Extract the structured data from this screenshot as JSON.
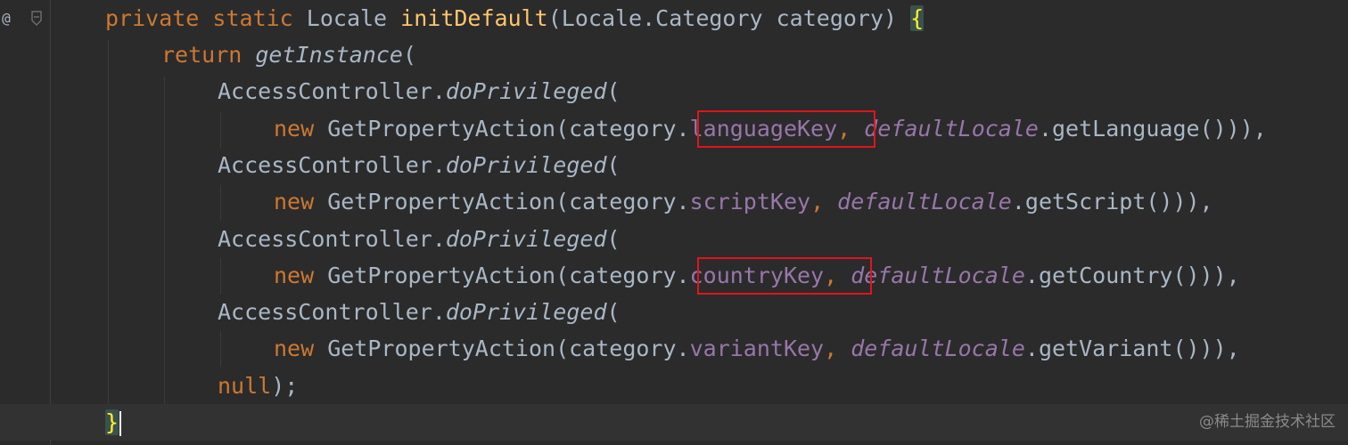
{
  "gutter": {
    "override_marker": "@"
  },
  "code": {
    "line1": {
      "kw1": "private",
      "kw2": "static",
      "type": "Locale",
      "method": "initDefault",
      "params": "(Locale.Category category) ",
      "brace": "{"
    },
    "line2": {
      "kw": "return",
      "method": "getInstance",
      "rest": "("
    },
    "line3": {
      "cls": "AccessController.",
      "method": "doPrivileged",
      "rest": "("
    },
    "line4": {
      "kw": "new",
      "pre": " GetPropertyAction(category.",
      "field": "languageKey",
      "comma": ", ",
      "sfield": "defaultLocale",
      "post": ".getLanguage())),"
    },
    "line5": {
      "cls": "AccessController.",
      "method": "doPrivileged",
      "rest": "("
    },
    "line6": {
      "kw": "new",
      "pre": " GetPropertyAction(category.",
      "field": "scriptKey",
      "comma": ", ",
      "sfield": "defaultLocale",
      "post": ".getScript())),"
    },
    "line7": {
      "cls": "AccessController.",
      "method": "doPrivileged",
      "rest": "("
    },
    "line8": {
      "kw": "new",
      "pre": " GetPropertyAction(category.",
      "field": "countryKey",
      "comma": ", ",
      "sfield": "defaultLocale",
      "post": ".getCountry())),"
    },
    "line9": {
      "cls": "AccessController.",
      "method": "doPrivileged",
      "rest": "("
    },
    "line10": {
      "kw": "new",
      "pre": " GetPropertyAction(category.",
      "field": "variantKey",
      "comma": ", ",
      "sfield": "defaultLocale",
      "post": ".getVariant())),"
    },
    "line11": {
      "kw": "null",
      "rest": ");"
    },
    "line12": {
      "brace": "}"
    }
  },
  "watermark": "@稀土掘金技术社区",
  "colors": {
    "background": "#2b2b2b",
    "keyword": "#cc7832",
    "method_decl": "#ffc66d",
    "field": "#9876aa",
    "default_text": "#a9b7c6",
    "highlight_box": "#e0141e"
  }
}
